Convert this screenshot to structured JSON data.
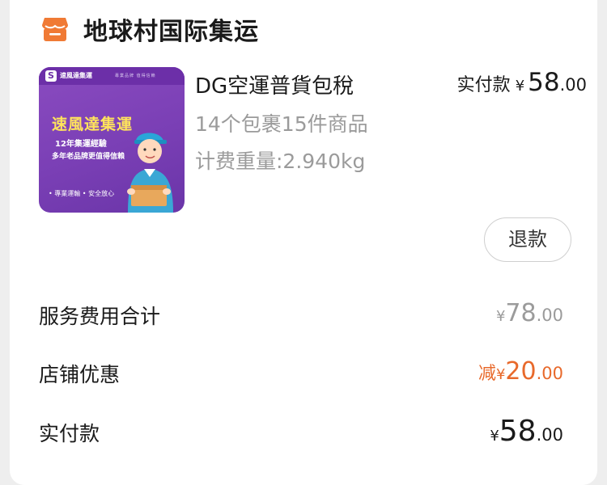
{
  "shop": {
    "name": "地球村国际集运",
    "icon": "shop-icon",
    "accent_color": "#f07a35"
  },
  "product": {
    "title": "DG空運普貨包稅",
    "package_count": "14个包裹15件商品",
    "weight": "计费重量:2.940kg",
    "thumbnail": {
      "brand": "速風達集運",
      "slogan": "專業品牌 值得信賴",
      "headline": "速風達集運",
      "line1": "12年集運經驗",
      "line2": "多年老品牌更值得信賴",
      "footer": "• 專業運輸  • 安全放心"
    }
  },
  "paid_amount": {
    "label": "实付款",
    "symbol": "¥",
    "integer": "58",
    "decimal": ".00"
  },
  "refund_button": {
    "label": "退款"
  },
  "summary": {
    "service_fee": {
      "label": "服务费用合计",
      "prefix": "",
      "symbol": "¥",
      "integer": "78",
      "decimal": ".00"
    },
    "shop_discount": {
      "label": "店铺优惠",
      "prefix": "减",
      "symbol": "¥",
      "integer": "20",
      "decimal": ".00",
      "color": "#e8692b"
    },
    "actual_paid": {
      "label": "实付款",
      "prefix": "",
      "symbol": "¥",
      "integer": "58",
      "decimal": ".00"
    }
  }
}
